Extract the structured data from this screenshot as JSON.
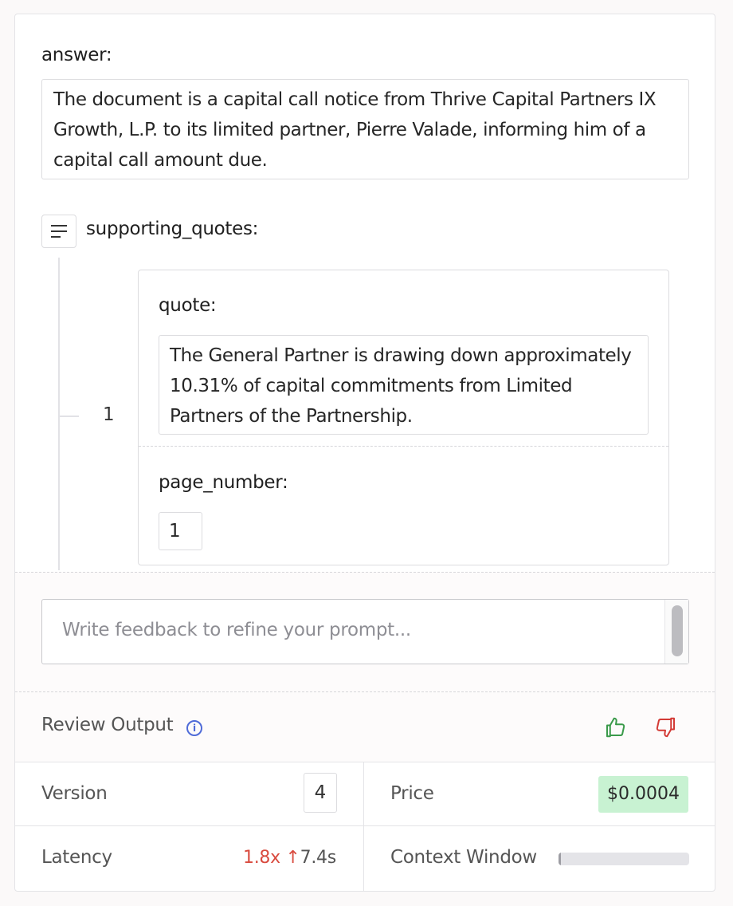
{
  "answer": {
    "label": "answer:",
    "value": "The document is a capital call notice from Thrive Capital Partners IX Growth, L.P. to its limited partner, Pierre Valade, informing him of a capital call amount due."
  },
  "supporting_quotes": {
    "label": "supporting_quotes:",
    "icon": "list-icon",
    "items": [
      {
        "index": "1",
        "quote_label": "quote:",
        "quote": "The General Partner is drawing down approximately 10.31% of capital commitments from Limited Partners of the Partnership.",
        "page_number_label": "page_number:",
        "page_number": "1"
      }
    ]
  },
  "feedback": {
    "placeholder": "Write feedback to refine your prompt..."
  },
  "review": {
    "label": "Review Output",
    "info_icon": "info-icon",
    "thumbs_up_icon": "thumbs-up-icon",
    "thumbs_down_icon": "thumbs-down-icon",
    "thumbs_up_color": "#3a9a4a",
    "thumbs_down_color": "#d33a35"
  },
  "stats": {
    "version_label": "Version",
    "version_value": "4",
    "price_label": "Price",
    "price_value": "$0.0004",
    "price_badge_color": "#c8f2d2",
    "latency_label": "Latency",
    "latency_multiplier": "1.8x",
    "latency_arrow": "↑",
    "latency_time": "7.4s",
    "latency_color": "#d94b3f",
    "context_window_label": "Context Window",
    "context_window_fraction": 0.02
  }
}
